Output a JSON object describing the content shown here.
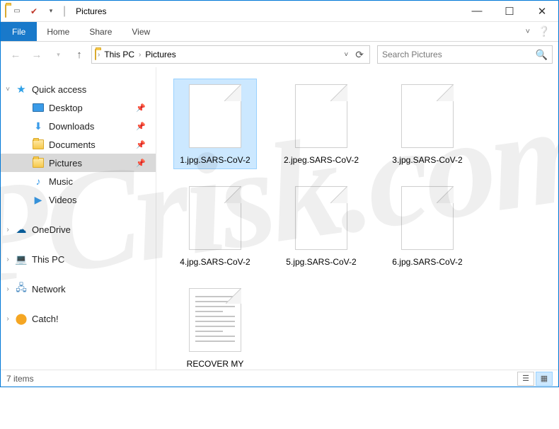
{
  "titlebar": {
    "title": "Pictures"
  },
  "ribbon": {
    "file": "File",
    "tabs": [
      "Home",
      "Share",
      "View"
    ]
  },
  "address": {
    "crumbs": [
      "This PC",
      "Pictures"
    ]
  },
  "search": {
    "placeholder": "Search Pictures"
  },
  "nav": {
    "quick_access": "Quick access",
    "items": [
      {
        "label": "Desktop",
        "pinned": true
      },
      {
        "label": "Downloads",
        "pinned": true
      },
      {
        "label": "Documents",
        "pinned": true
      },
      {
        "label": "Pictures",
        "pinned": true,
        "selected": true
      },
      {
        "label": "Music",
        "pinned": false
      },
      {
        "label": "Videos",
        "pinned": false
      }
    ],
    "onedrive": "OneDrive",
    "thispc": "This PC",
    "network": "Network",
    "catch": "Catch!"
  },
  "files": [
    {
      "name": "1.jpg.SARS-CoV-2",
      "type": "unknown",
      "selected": true
    },
    {
      "name": "2.jpeg.SARS-CoV-2",
      "type": "unknown"
    },
    {
      "name": "3.jpg.SARS-CoV-2",
      "type": "unknown"
    },
    {
      "name": "4.jpg.SARS-CoV-2",
      "type": "unknown"
    },
    {
      "name": "5.jpg.SARS-CoV-2",
      "type": "unknown"
    },
    {
      "name": "6.jpg.SARS-CoV-2",
      "type": "unknown"
    },
    {
      "name": "RECOVER MY ENCRYPTED FILES.TXT",
      "type": "txt"
    }
  ],
  "status": {
    "count_label": "7 items"
  },
  "watermark": "PCrisk.com"
}
